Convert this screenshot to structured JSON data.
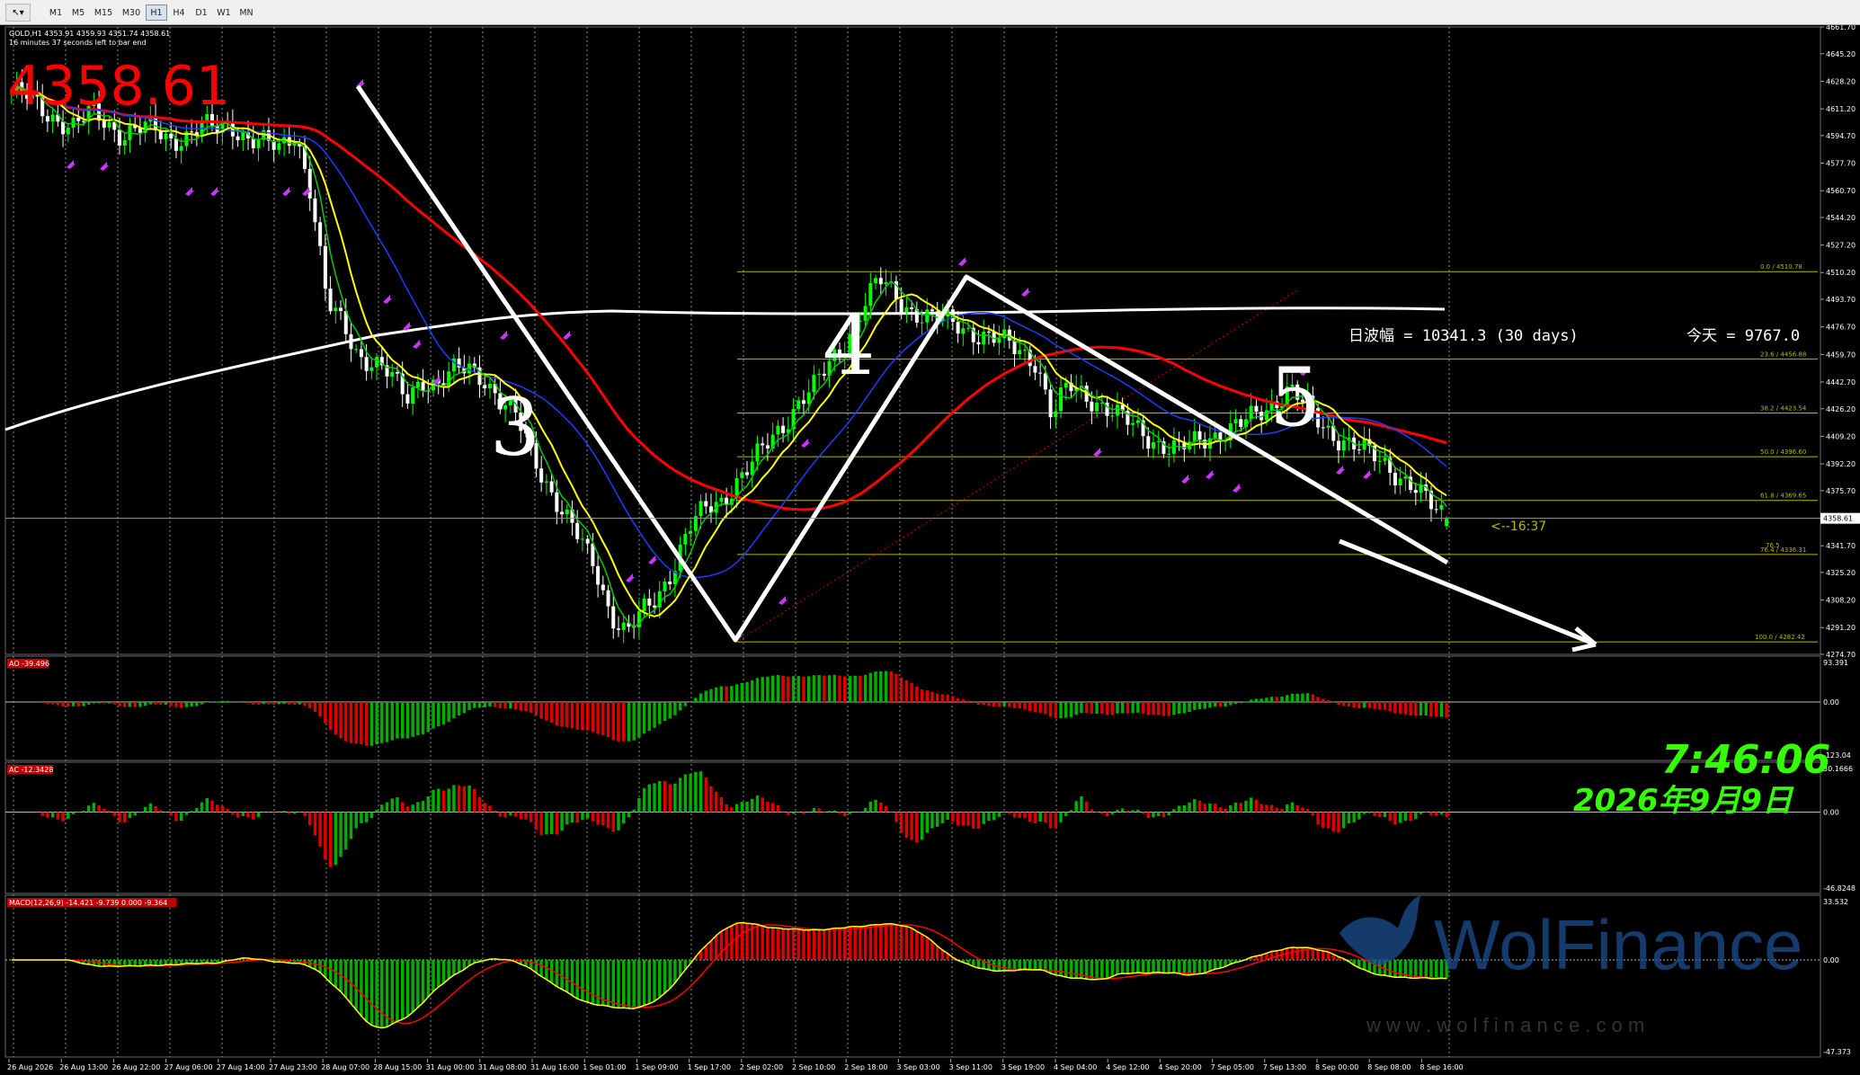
{
  "toolbar": {
    "timeframes": [
      "M1",
      "M5",
      "M15",
      "M30",
      "H1",
      "H4",
      "D1",
      "W1",
      "MN"
    ],
    "active": "H1"
  },
  "header": {
    "symbol_line": "GOLD,H1  4353.91 4359.93 4351.74 4358.61",
    "timer_line": "16 minutes 37 seconds left to bar end",
    "big_price": "4358.61",
    "price_tag": "4358.61",
    "countdown": "<--16:37"
  },
  "annotations": {
    "wave_labels": [
      "3",
      "4",
      "5"
    ],
    "daily_range": "日波幅 = 10341.3  (30 days)",
    "today": "今天 = 9767.0"
  },
  "clock": {
    "time": "7:46:06",
    "date": "2026年9月9日"
  },
  "watermark": {
    "brand": "WolFinance",
    "url": "w w w . w o l f i n a n c e . c o m"
  },
  "colors": {
    "price_up": "#00ff00",
    "price_down": "#ffffff",
    "ma_red": "#ff0000",
    "ma_blue": "#1e3cff",
    "ma_yellow": "#ffff00",
    "ma_green": "#00cc00",
    "fib": "#b8b800",
    "hist_up": "#00b000",
    "hist_down": "#e00000",
    "clock": "#33ff00",
    "arrow_marker": "#cc33ff"
  },
  "chart_data": {
    "type": "candlestick",
    "symbol": "GOLD",
    "timeframe": "H1",
    "last": {
      "open": 4353.91,
      "high": 4359.93,
      "low": 4351.74,
      "close": 4358.61
    },
    "y_axis_ticks": [
      "4661.70",
      "4645.20",
      "4628.20",
      "4611.20",
      "4594.70",
      "4577.70",
      "4560.70",
      "4544.20",
      "4527.20",
      "4510.20",
      "4493.70",
      "4476.70",
      "4459.70",
      "4442.70",
      "4426.20",
      "4409.20",
      "4392.20",
      "4375.70",
      "4358.70",
      "4341.70",
      "4325.20",
      "4308.20",
      "4291.20",
      "4274.70"
    ],
    "y_axis_range": [
      4274.7,
      4661.7
    ],
    "x_axis_labels": [
      "26 Aug 2026",
      "26 Aug 13:00",
      "26 Aug 22:00",
      "27 Aug 06:00",
      "27 Aug 14:00",
      "27 Aug 23:00",
      "28 Aug 07:00",
      "28 Aug 15:00",
      "31 Aug 00:00",
      "31 Aug 08:00",
      "31 Aug 16:00",
      "1 Sep 01:00",
      "1 Sep 09:00",
      "1 Sep 17:00",
      "2 Sep 02:00",
      "2 Sep 10:00",
      "2 Sep 18:00",
      "3 Sep 03:00",
      "3 Sep 11:00",
      "3 Sep 19:00",
      "4 Sep 04:00",
      "4 Sep 12:00",
      "4 Sep 20:00",
      "7 Sep 05:00",
      "7 Sep 13:00",
      "8 Sep 00:00",
      "8 Sep 08:00",
      "8 Sep 16:00"
    ],
    "approx_close_path": [
      4622,
      4618,
      4610,
      4605,
      4600,
      4608,
      4603,
      4596,
      4599,
      4598,
      4592,
      4595,
      4600,
      4598,
      4601,
      4594,
      4590,
      4585,
      4598,
      4560,
      4490,
      4478,
      4460,
      4455,
      4446,
      4432,
      4446,
      4440,
      4448,
      4452,
      4446,
      4430,
      4420,
      4400,
      4380,
      4360,
      4345,
      4330,
      4300,
      4286,
      4300,
      4312,
      4330,
      4352,
      4364,
      4370,
      4382,
      4392,
      4405,
      4418,
      4432,
      4440,
      4455,
      4470,
      4490,
      4505,
      4496,
      4488,
      4483,
      4480,
      4478,
      4474,
      4470,
      4466,
      4462,
      4456,
      4420,
      4440,
      4436,
      4430,
      4422,
      4416,
      4410,
      4404,
      4400,
      4405,
      4410,
      4413,
      4416,
      4422,
      4430,
      4440,
      4428,
      4416,
      4410,
      4405,
      4398,
      4392,
      4386,
      4378,
      4365,
      4358.61
    ],
    "fibonacci": [
      {
        "level": "0.0",
        "price": 4510.78
      },
      {
        "level": "23.6",
        "price": 4456.88
      },
      {
        "level": "38.2",
        "price": 4423.54
      },
      {
        "level": "50.0",
        "price": 4396.6
      },
      {
        "level": "61.8",
        "price": 4369.65
      },
      {
        "level": "76.4",
        "price": 4336.31
      },
      {
        "level": "100.0",
        "price": 4282.42
      }
    ],
    "fib_labels": [
      "0.0 / 4510.78",
      "23.6 / 4456.88",
      "38.2 / 4423.54",
      "50.0 / 4396.60",
      "61.8 / 4369.65",
      "76.4 / 4336.31",
      "100.0 / 4282.42"
    ],
    "fib_extra_label": "76.5",
    "indicators": [
      {
        "name": "AO",
        "label": "AO -39.496",
        "max": "93.391",
        "zero": "0.00",
        "min": "-123.04"
      },
      {
        "name": "AC",
        "label": "AC -12.3428",
        "max": "30.1666",
        "zero": "0.00",
        "min": "-46.8248"
      },
      {
        "name": "MACD",
        "label": "MACD(12,26,9) -14.421 -9.739 0.000 -9.364",
        "max": "33.532",
        "zero": "0.00",
        "min": "-47.373"
      }
    ]
  }
}
